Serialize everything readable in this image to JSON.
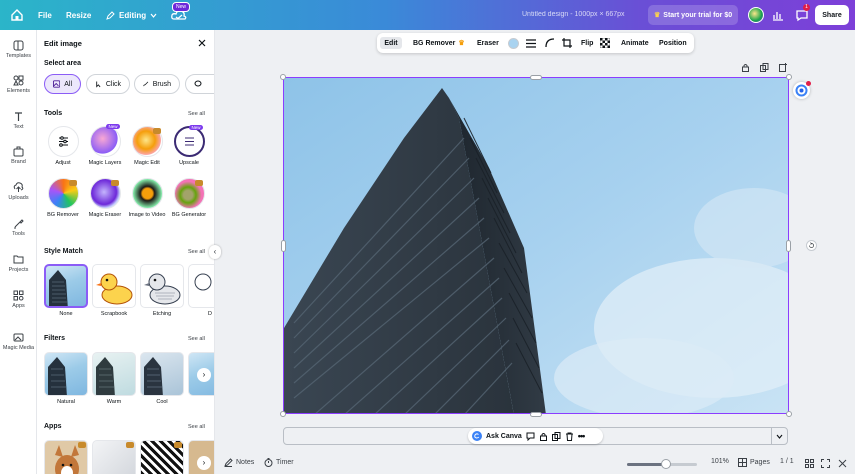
{
  "topbar": {
    "file": "File",
    "resize": "Resize",
    "editing": "Editing",
    "new_badge": "New",
    "design_title": "Untitled design - 1000px × 667px",
    "trial": "Start your trial for $0",
    "notifications": "1",
    "share": "Share"
  },
  "rail": [
    {
      "label": "Templates",
      "icon": "templates-icon"
    },
    {
      "label": "Elements",
      "icon": "elements-icon"
    },
    {
      "label": "Text",
      "icon": "text-icon"
    },
    {
      "label": "Brand",
      "icon": "brand-icon"
    },
    {
      "label": "Uploads",
      "icon": "uploads-icon"
    },
    {
      "label": "Tools",
      "icon": "tools-icon"
    },
    {
      "label": "Projects",
      "icon": "projects-icon"
    },
    {
      "label": "Apps",
      "icon": "apps-icon"
    },
    {
      "label": "Magic Media",
      "icon": "magic-media-icon"
    }
  ],
  "panel": {
    "title": "Edit image",
    "select_area": "Select area",
    "chips": [
      "All",
      "Click",
      "Brush"
    ],
    "tools_heading": "Tools",
    "see_all": "See all",
    "tools": [
      {
        "label": "Adjust",
        "badge": ""
      },
      {
        "label": "Magic Layers",
        "badge": "New"
      },
      {
        "label": "Magic Edit",
        "badge": ""
      },
      {
        "label": "Upscale",
        "badge": "New"
      },
      {
        "label": "BG Remover",
        "badge": ""
      },
      {
        "label": "Magic Eraser",
        "badge": ""
      },
      {
        "label": "Image to Video",
        "badge": ""
      },
      {
        "label": "BG Generator",
        "badge": ""
      }
    ],
    "style_heading": "Style Match",
    "styles": [
      "None",
      "Scrapbook",
      "Etching",
      "D"
    ],
    "filters_heading": "Filters",
    "filters": [
      "Natural",
      "Warm",
      "Cool"
    ],
    "apps_heading": "Apps"
  },
  "context_toolbar": {
    "edit": "Edit",
    "bg_remover": "BG Remover",
    "eraser": "Eraser",
    "flip": "Flip",
    "animate": "Animate",
    "position": "Position",
    "swatch_color": "#a9d3f0"
  },
  "bottom": {
    "ask_canva": "Ask Canva",
    "notes": "Notes",
    "timer": "Timer",
    "zoom": "101%",
    "zoom_fraction": 0.55,
    "pages": "Pages",
    "page_count": "1 / 1"
  },
  "colors": {
    "accent": "#8b3dff",
    "sky": "#9ccbe8"
  }
}
